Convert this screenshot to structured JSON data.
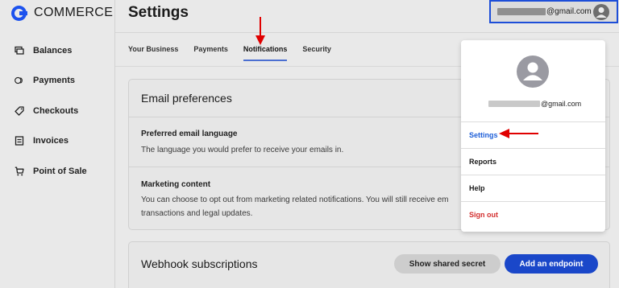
{
  "brand": {
    "name": "COMMERCE",
    "logo_icon": "coinbase-c-logo-icon",
    "accent": "#1c52ee"
  },
  "sidebar": {
    "items": [
      {
        "label": "Balances",
        "icon": "balances-icon"
      },
      {
        "label": "Payments",
        "icon": "payments-icon"
      },
      {
        "label": "Checkouts",
        "icon": "tag-icon"
      },
      {
        "label": "Invoices",
        "icon": "invoice-icon"
      },
      {
        "label": "Point of Sale",
        "icon": "cart-icon"
      }
    ]
  },
  "header": {
    "title": "Settings",
    "account_email_domain": "@gmail.com"
  },
  "tabs": [
    {
      "label": "Your Business",
      "active": false
    },
    {
      "label": "Payments",
      "active": false
    },
    {
      "label": "Notifications",
      "active": true
    },
    {
      "label": "Security",
      "active": false
    }
  ],
  "email_preferences": {
    "title": "Email preferences",
    "language_label": "Preferred email language",
    "language_desc": "The language you would prefer to receive your emails in.",
    "marketing_label": "Marketing content",
    "marketing_desc_line1": "You can choose to opt out from marketing related notifications. You will still receive em",
    "marketing_desc_line2": "transactions and legal updates."
  },
  "webhooks": {
    "title": "Webhook subscriptions",
    "show_secret_label": "Show shared secret",
    "add_endpoint_label": "Add an endpoint"
  },
  "dropdown": {
    "email_domain": "@gmail.com",
    "items": [
      {
        "label": "Settings",
        "color": "#1d5ed8"
      },
      {
        "label": "Reports",
        "color": "#1a1a1a"
      },
      {
        "label": "Help",
        "color": "#1a1a1a"
      },
      {
        "label": "Sign out",
        "color": "#d32f2f"
      }
    ]
  },
  "annotation_color": "#e00000"
}
